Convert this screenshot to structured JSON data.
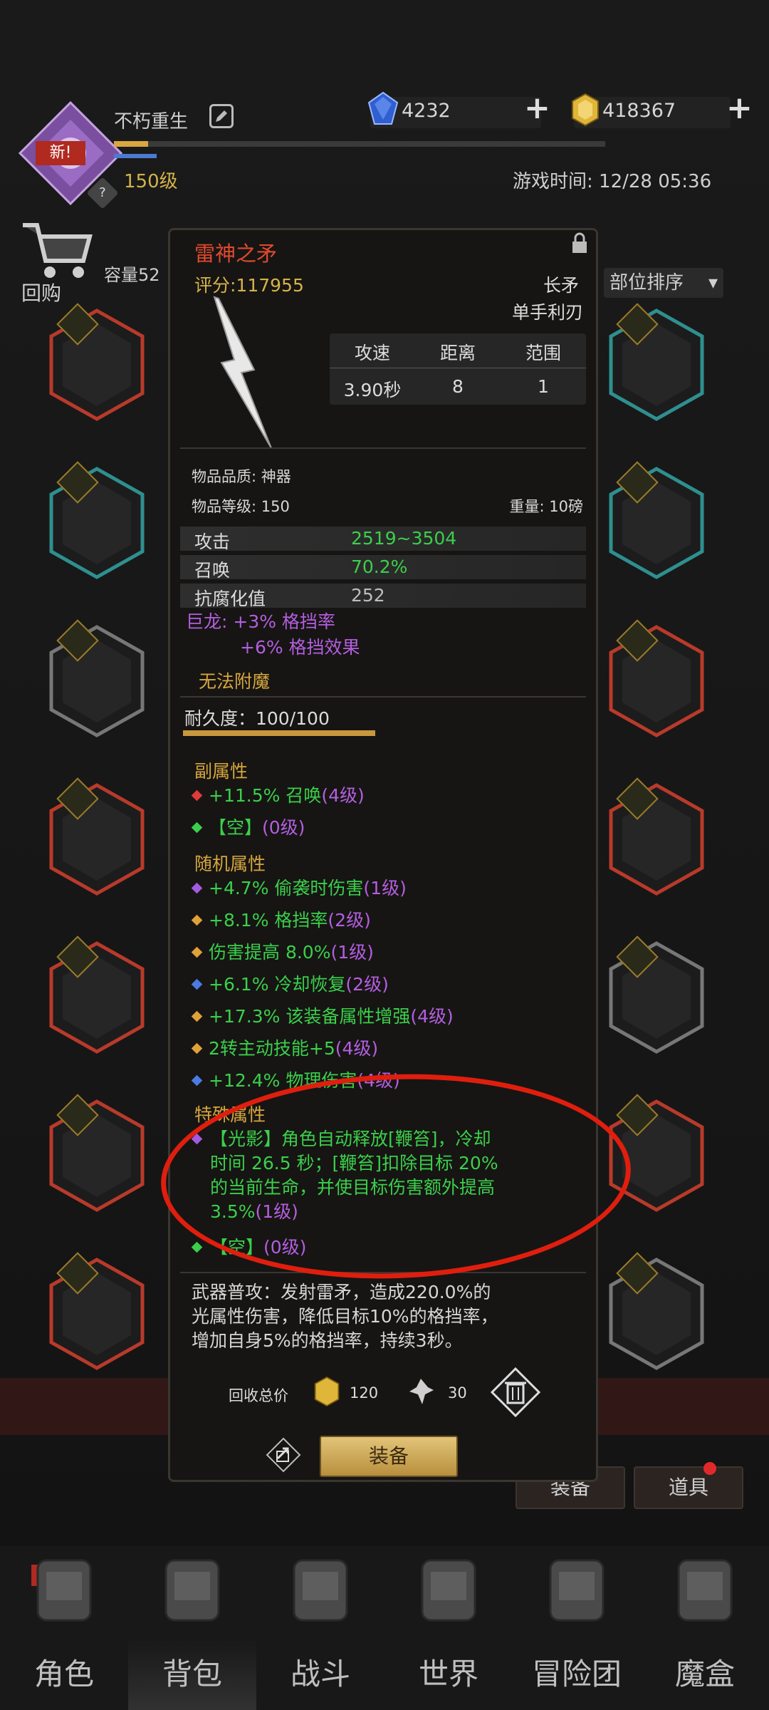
{
  "header": {
    "player_name": "不朽重生",
    "avatar_badge": "新!",
    "avatar_sub_badge": "?",
    "level": "150级",
    "xp_fill": 0.07,
    "gems": "4232",
    "gold": "418367",
    "game_time": "游戏时间: 12/28 05:36"
  },
  "bag": {
    "recycle_label": "回购",
    "capacity": "容量52",
    "sort_label": "部位排序",
    "tab_equip": "装备",
    "tab_items": "道具"
  },
  "item": {
    "name": "雷神之矛",
    "score": "评分:117955",
    "type_main": "长矛",
    "type_sub": "单手利刃",
    "stat_headers": [
      "攻速",
      "距离",
      "范围"
    ],
    "stat_values": [
      "3.90秒",
      "8",
      "1"
    ],
    "quality": "物品品质: 神器",
    "item_level": "物品等级: 150",
    "weight": "重量: 10磅",
    "base_stats": [
      {
        "label": "攻击",
        "value": "2519~3504",
        "color": "#3bcf4b"
      },
      {
        "label": "召唤",
        "value": "70.2%",
        "color": "#3bcf4b"
      },
      {
        "label": "抗腐化值",
        "value": "252",
        "color": "#bdbdbd"
      }
    ],
    "set_bonus_1": "巨龙: +3% 格挡率",
    "set_bonus_2": "+6% 格挡效果",
    "no_enchant": "无法附魔",
    "durability": "耐久度：100/100",
    "durability_fill": 1.0,
    "secondary_title": "副属性",
    "secondary": [
      {
        "text": "+11.5% 召唤",
        "lvl": "(4级)",
        "dot": "#e03a3a"
      },
      {
        "text": "【空】",
        "lvl": "(0级)",
        "dot": "#3bcf4b"
      }
    ],
    "random_title": "随机属性",
    "random": [
      {
        "text": "+4.7% 偷袭时伤害",
        "lvl": "(1级)",
        "dot": "#a35ae0"
      },
      {
        "text": "+8.1% 格挡率",
        "lvl": "(2级)",
        "dot": "#e0a03a"
      },
      {
        "text": "伤害提高 8.0%",
        "lvl": "(1级)",
        "dot": "#e0a03a"
      },
      {
        "text": "+6.1% 冷却恢复",
        "lvl": "(2级)",
        "dot": "#4a7be0"
      },
      {
        "text": "+17.3% 该装备属性增强",
        "lvl": "(4级)",
        "dot": "#e0a03a"
      },
      {
        "text": "2转主动技能+5",
        "lvl": "(4级)",
        "dot": "#e0a03a"
      },
      {
        "text": "+12.4% 物理伤害",
        "lvl": "(4级)",
        "dot": "#4a7be0"
      }
    ],
    "special_title": "特殊属性",
    "special_main_lines": [
      "【光影】角色自动释放[鞭笞]，冷却",
      "时间 26.5 秒；[鞭笞]扣除目标 20%",
      "的当前生命，并使目标伤害额外提高"
    ],
    "special_main_last": "3.5%",
    "special_main_lvl": "(1级)",
    "special_empty": "【空】",
    "special_empty_lvl": "(0级)",
    "description_lines": [
      "武器普攻：发射雷矛，造成220.0%的",
      "光属性伤害，降低目标10%的格挡率，",
      "增加自身5%的格挡率，持续3秒。"
    ],
    "recycle_label": "回收总价",
    "recycle_gold": "120",
    "recycle_shard": "30",
    "equip_label": "装备"
  },
  "nav": {
    "items": [
      "角色",
      "背包",
      "战斗",
      "世界",
      "冒险团",
      "魔盒"
    ],
    "new_badge": "新!"
  },
  "colors": {
    "title_red": "#e04a2e",
    "gold": "#d6a63e",
    "green": "#3bcf4b",
    "purple": "#b45ee0",
    "annotation_red": "#e01e0e"
  }
}
